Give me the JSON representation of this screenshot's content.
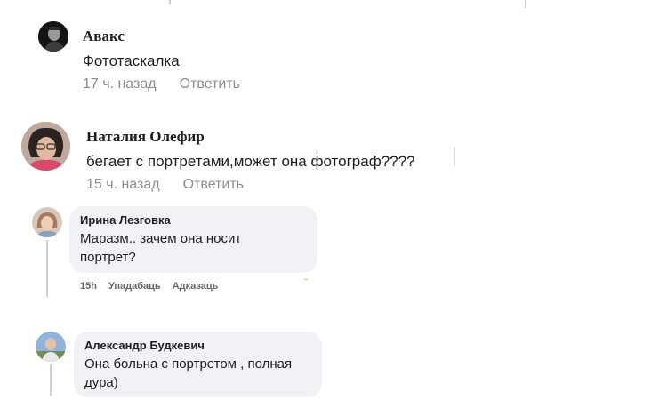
{
  "comments": [
    {
      "author": "Авакс",
      "text": "Фототаскалка",
      "time": "17 ч. назад",
      "reply": "Ответить",
      "avatar_icon": "monochrome-portrait-avatar"
    },
    {
      "author": "Наталия Олефир",
      "text": "бегает с портретами,может она фотограф????",
      "time": "15 ч. назад",
      "reply": "Ответить",
      "avatar_icon": "woman-with-glasses-avatar"
    }
  ],
  "replies": [
    {
      "author": "Ирина Лезговка",
      "text_line1": "Маразм.. зачем она носит",
      "text_line2": "портрет?",
      "time": "15h",
      "like": "Упадабаць",
      "reply": "Адказаць",
      "avatar_icon": "woman-avatar"
    },
    {
      "author": "Александр Будкевич",
      "text_line1": "Она больна с портретом , полная",
      "text_line2": "дура)",
      "avatar_icon": "man-outdoors-avatar"
    }
  ],
  "colors": {
    "bubble_bg": "#f0f2f5",
    "meta_gray": "#8a8d91",
    "thread_line": "#ced0d4"
  }
}
